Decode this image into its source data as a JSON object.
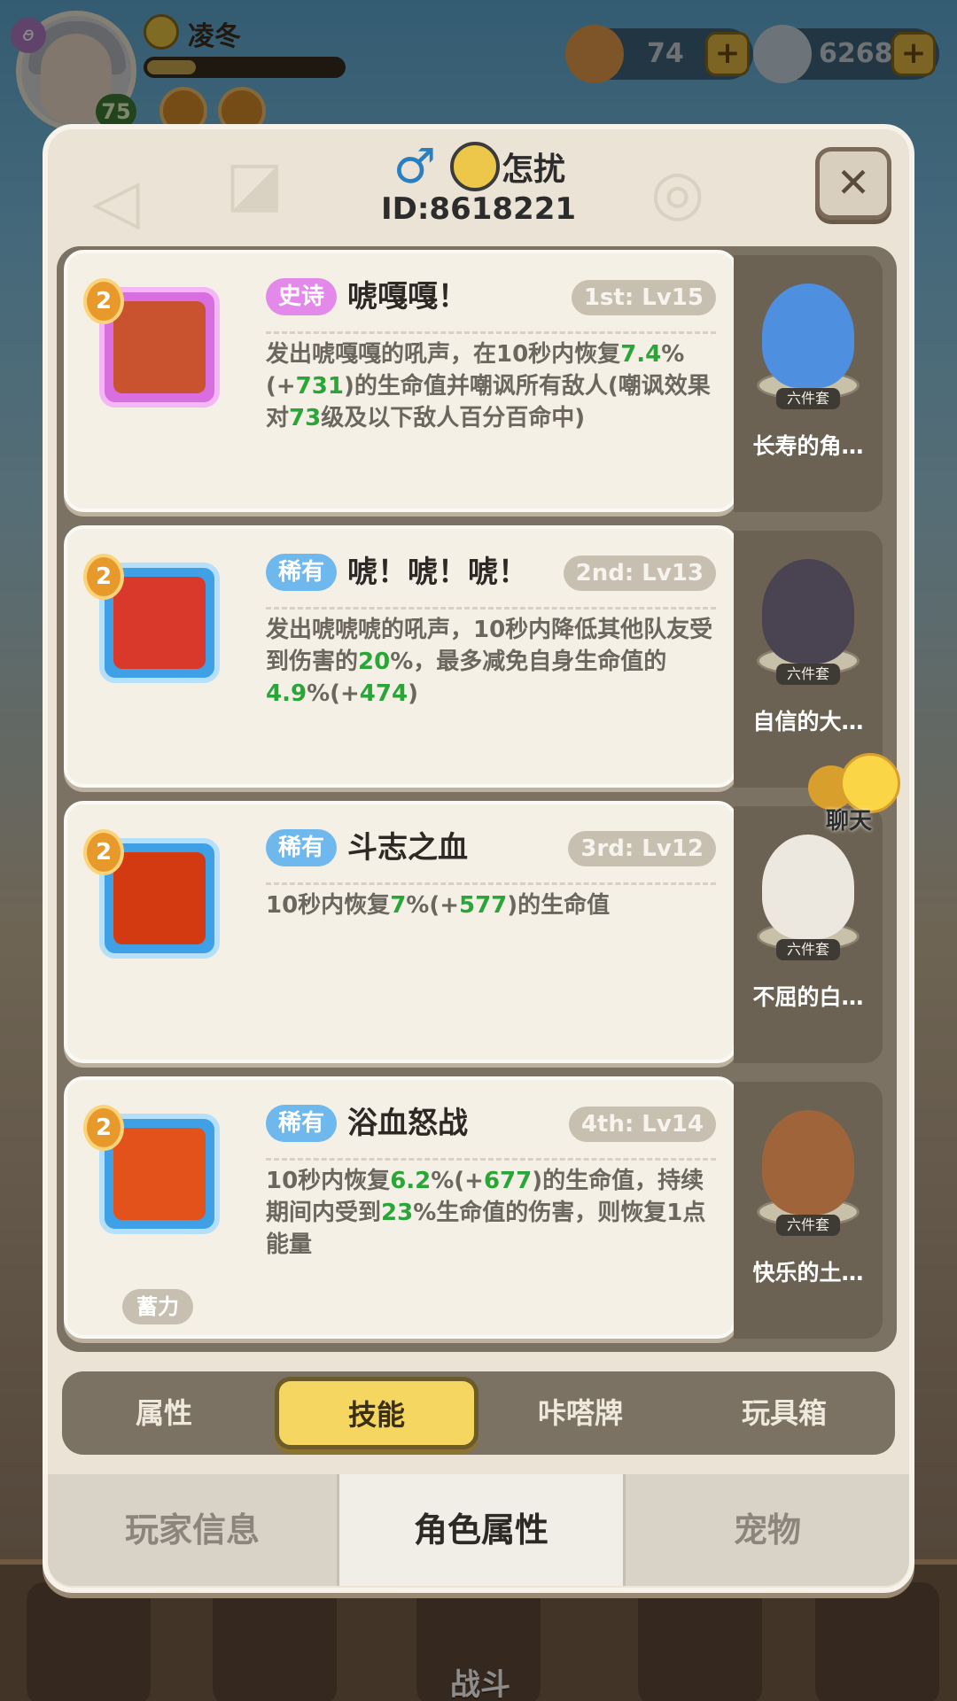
{
  "hud": {
    "player_name": "凌冬",
    "level": "75",
    "currency_1": "74",
    "currency_2": "62688",
    "plus_label": "+",
    "swirl": "ꪮ",
    "exp_progress": 0.25
  },
  "panel": {
    "gender_icon": "♂",
    "name": "怎扰",
    "id": "ID:8618221",
    "close_label": "✕"
  },
  "skills": [
    {
      "rank": "2",
      "rarity": "史诗",
      "rarity_type": "epic",
      "name": "唬嘎嘎！",
      "lv": "1st: Lv15",
      "desc": [
        {
          "t": "发出唬嘎嘎的吼声，在10秒内恢复",
          "g": false
        },
        {
          "t": "7.4",
          "g": true
        },
        {
          "t": "%(+",
          "g": false
        },
        {
          "t": "731",
          "g": true
        },
        {
          "t": ")的生命值并嘲讽所有敌人(嘲讽效果对",
          "g": false
        },
        {
          "t": "73",
          "g": true
        },
        {
          "t": "级及以下敌人百分百命中)",
          "g": false
        }
      ],
      "pet_name": "长寿的角…",
      "pet_tag": "六件套",
      "pet_color": "#4e8fe0"
    },
    {
      "rank": "2",
      "rarity": "稀有",
      "rarity_type": "rare",
      "name": "唬！唬！唬！",
      "lv": "2nd: Lv13",
      "desc": [
        {
          "t": "发出唬唬唬的吼声，10秒内降低其他队友受到伤害的",
          "g": false
        },
        {
          "t": "20",
          "g": true
        },
        {
          "t": "%，最多减免自身生命值的",
          "g": false
        },
        {
          "t": "4.9",
          "g": true
        },
        {
          "t": "%(+",
          "g": false
        },
        {
          "t": "474",
          "g": true
        },
        {
          "t": ")",
          "g": false
        }
      ],
      "pet_name": "自信的大…",
      "pet_tag": "六件套",
      "pet_color": "#4a4452"
    },
    {
      "rank": "2",
      "rarity": "稀有",
      "rarity_type": "rare",
      "name": "斗志之血",
      "lv": "3rd: Lv12",
      "desc": [
        {
          "t": "10秒内恢复",
          "g": false
        },
        {
          "t": "7",
          "g": true
        },
        {
          "t": "%(+",
          "g": false
        },
        {
          "t": "577",
          "g": true
        },
        {
          "t": ")的生命值",
          "g": false
        }
      ],
      "pet_name": "不屈的白…",
      "pet_tag": "六件套",
      "pet_color": "#ece8e0"
    },
    {
      "rank": "2",
      "rarity": "稀有",
      "rarity_type": "rare",
      "name": "浴血怒战",
      "lv": "4th: Lv14",
      "desc": [
        {
          "t": "10秒内恢复",
          "g": false
        },
        {
          "t": "6.2",
          "g": true
        },
        {
          "t": "%(+",
          "g": false
        },
        {
          "t": "677",
          "g": true
        },
        {
          "t": ")的生命值，持续期间内受到",
          "g": false
        },
        {
          "t": "23",
          "g": true
        },
        {
          "t": "%生命值的伤害，则恢复1点能量",
          "g": false
        }
      ],
      "tag": "蓄力",
      "pet_name": "快乐的土…",
      "pet_tag": "六件套",
      "pet_color": "#a0643a"
    }
  ],
  "chat": {
    "label": "聊天"
  },
  "subtabs": [
    "属性",
    "技能",
    "咔嗒牌",
    "玩具箱"
  ],
  "tabs": [
    "玩家信息",
    "角色属性",
    "宠物"
  ],
  "bottom_nav": {
    "battle": "战斗"
  },
  "colors": {
    "accent_yellow": "#f5d660",
    "green_value": "#2aa638",
    "epic": "#e389ea",
    "rare": "#6fb8ee"
  }
}
